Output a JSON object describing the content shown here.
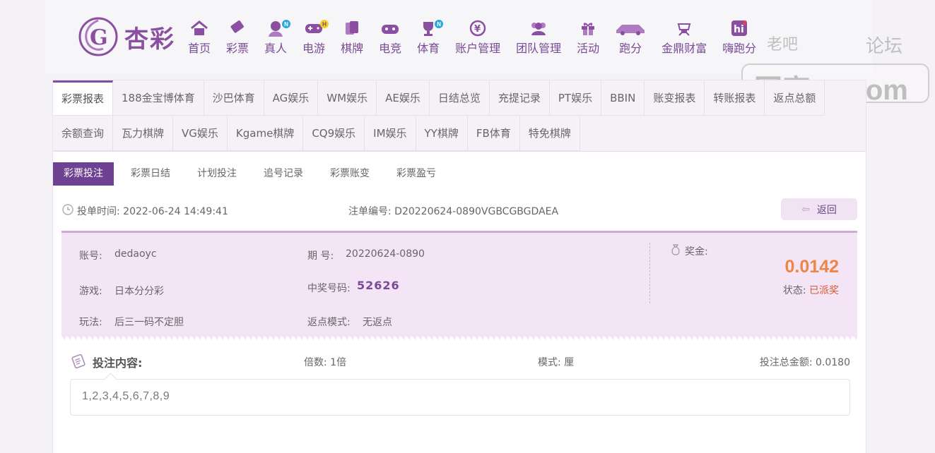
{
  "brand": {
    "name": "杏彩",
    "logo_letter": "G",
    "colors": {
      "primary": "#7e4d9c",
      "accent": "#ec8644",
      "danger": "#e0572f",
      "ticket_bg": "#f4e5f6"
    }
  },
  "nav": [
    {
      "label": "首页",
      "icon": "home-icon"
    },
    {
      "label": "彩票",
      "icon": "lottery-ticket-icon"
    },
    {
      "label": "真人",
      "icon": "live-dealer-icon",
      "badge": "N"
    },
    {
      "label": "电游",
      "icon": "gamepad-icon",
      "badge": "H"
    },
    {
      "label": "棋牌",
      "icon": "cards-icon"
    },
    {
      "label": "电竞",
      "icon": "esports-controller-icon"
    },
    {
      "label": "体育",
      "icon": "trophy-icon",
      "badge": "N"
    },
    {
      "label": "账户管理",
      "icon": "yen-coin-icon"
    },
    {
      "label": "团队管理",
      "icon": "team-icon"
    },
    {
      "label": "活动",
      "icon": "gift-icon"
    },
    {
      "label": "跑分",
      "icon": "running-car-icon"
    },
    {
      "label": "金鼎财富",
      "icon": "treasure-icon"
    },
    {
      "label": "嗨跑分",
      "icon": "hi-icon"
    }
  ],
  "watermark": {
    "text": "回家14.com",
    "top_left": "老吧",
    "top_right": "论坛"
  },
  "tabs_row1": [
    "彩票报表",
    "188金宝博体育",
    "沙巴体育",
    "AG娱乐",
    "WM娱乐",
    "AE娱乐",
    "日结总览",
    "充提记录",
    "PT娱乐",
    "BBIN",
    "账变报表",
    "转账报表",
    "返点总额"
  ],
  "tabs_row2": [
    "余额查询",
    "瓦力棋牌",
    "VG娱乐",
    "Kgame棋牌",
    "CQ9娱乐",
    "IM娱乐",
    "YY棋牌",
    "FB体育",
    "特免棋牌"
  ],
  "subtabs": [
    "彩票投注",
    "彩票日结",
    "计划投注",
    "追号记录",
    "彩票账变",
    "彩票盈亏"
  ],
  "info": {
    "bet_time_label": "投单时间:",
    "bet_time": "2022-06-24 14:49:41",
    "order_no_label": "注单编号:",
    "order_no": "D20220624-0890VGBCGBGDAEA",
    "back_label": "返回"
  },
  "ticket": {
    "account_label": "账号:",
    "account": "dedaoyc",
    "game_label": "游戏:",
    "game": "日本分分彩",
    "play_label": "玩法:",
    "play": "后三一码不定胆",
    "period_label": "期 号:",
    "period": "20220624-0890",
    "winning_label": "中奖号码:",
    "winning_number": "52626",
    "rebate_label": "返点模式:",
    "rebate": "无返点",
    "prize_label": "奖金:",
    "prize_amount": "0.0142",
    "status_label": "状态:",
    "status_value": "已派奖"
  },
  "content": {
    "title": "投注内容:",
    "multiplier_label": "倍数:",
    "multiplier": "1倍",
    "mode_label": "模式:",
    "mode": "厘",
    "total_label": "投注总金额:",
    "total": "0.0180",
    "numbers": "1,2,3,4,5,6,7,8,9"
  }
}
